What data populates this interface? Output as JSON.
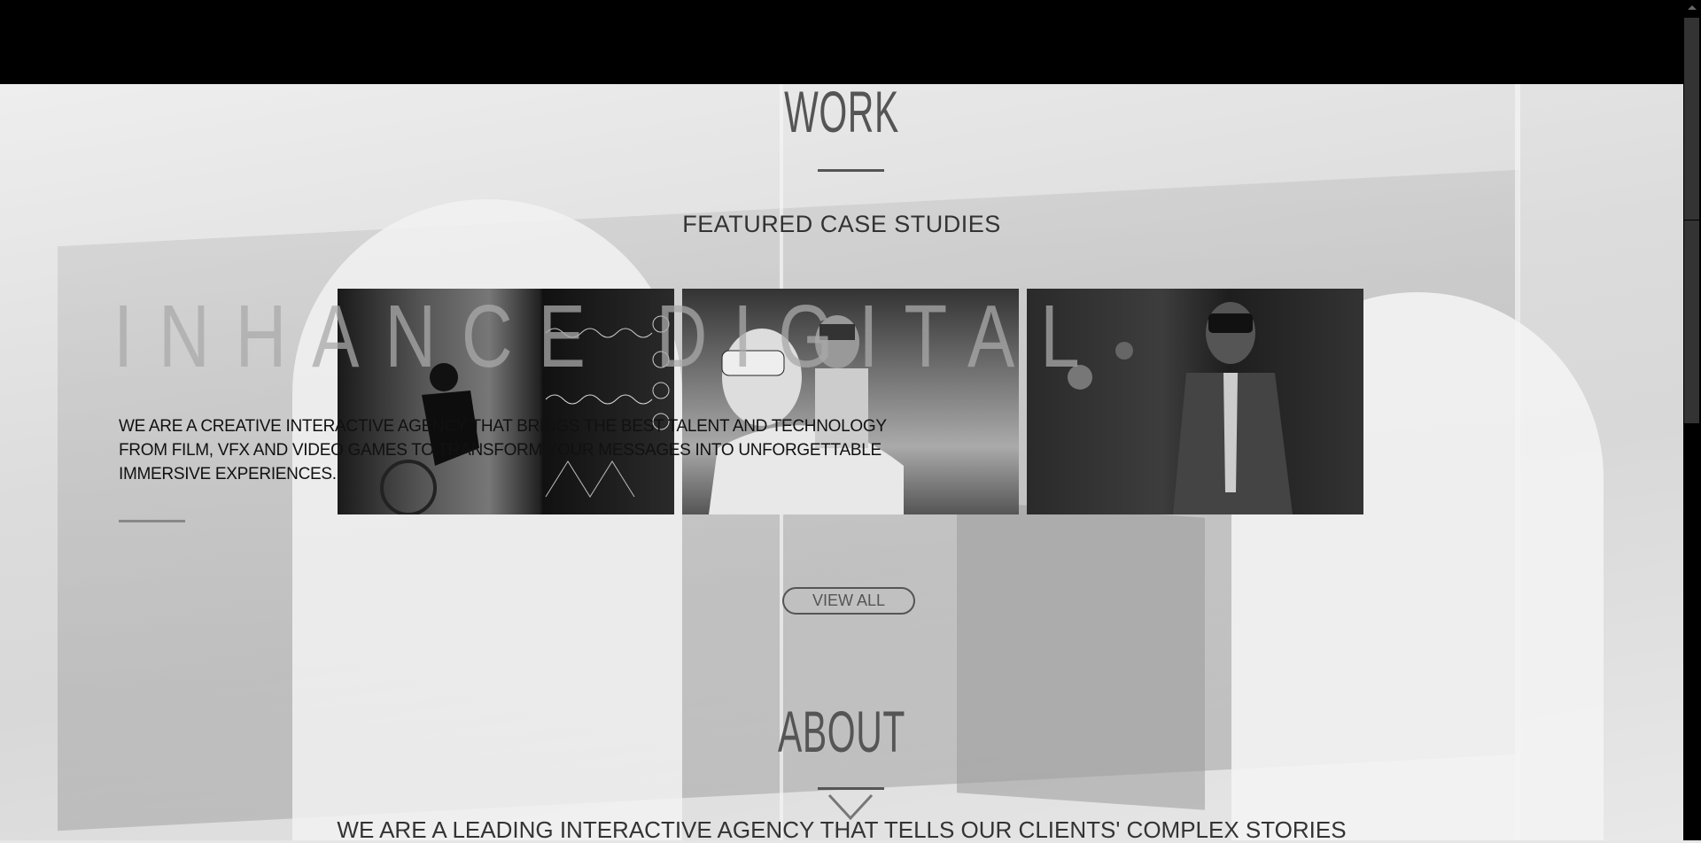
{
  "work": {
    "title": "WORK",
    "subtitle": "FEATURED CASE STUDIES",
    "view_all_label": "VIEW ALL",
    "case_studies": [
      {
        "name": "cycling-biometrics"
      },
      {
        "name": "vr-headset-audience"
      },
      {
        "name": "vr-presenter"
      }
    ]
  },
  "hero": {
    "brand": "INHANCE DIGITAL",
    "description": "WE ARE A CREATIVE INTERACTIVE AGENCY THAT BRINGS THE BEST TALENT AND TECHNOLOGY FROM FILM, VFX AND VIDEO GAMES TO TRANSFORM YOUR MESSAGES INTO UNFORGETTABLE IMMERSIVE EXPERIENCES."
  },
  "about": {
    "title": "ABOUT",
    "text": "WE ARE A LEADING INTERACTIVE AGENCY THAT TELLS OUR CLIENTS' COMPLEX STORIES"
  },
  "colors": {
    "header": "#000000",
    "accent": "#555555",
    "background": "#e6e6e6"
  }
}
